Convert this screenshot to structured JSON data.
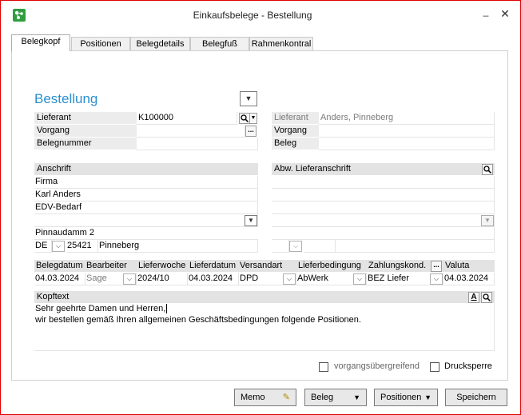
{
  "window": {
    "title": "Einkaufsbelege - Bestellung",
    "minimize": "_",
    "close": "✕"
  },
  "tabs": [
    {
      "label": "Belegkopf"
    },
    {
      "label": "Positionen"
    },
    {
      "label": "Belegdetails"
    },
    {
      "label": "Belegfuß"
    },
    {
      "label": "Rahmenkontral"
    }
  ],
  "heading": "Bestellung",
  "supplier_left": {
    "lieferant_label": "Lieferant",
    "lieferant_value": "K100000",
    "vorgang_label": "Vorgang",
    "vorgang_value": "",
    "belegnummer_label": "Belegnummer",
    "belegnummer_value": "",
    "ellipsis": "..."
  },
  "supplier_right": {
    "lieferant_label": "Lieferant",
    "lieferant_value": "Anders, Pinneberg",
    "vorgang_label": "Vorgang",
    "beleg_label": "Beleg"
  },
  "address": {
    "header": "Anschrift",
    "lines": [
      "Firma",
      "Karl Anders",
      "EDV-Bedarf"
    ],
    "street": "Pinnaudamm 2",
    "country": "DE",
    "zip": "25421",
    "city": "Pinneberg"
  },
  "alt_address": {
    "header": "Abw. Lieferanschrift"
  },
  "order_row": {
    "headers": {
      "belegdatum": "Belegdatum",
      "bearbeiter": "Bearbeiter",
      "lieferwoche": "Lieferwoche",
      "lieferdatum": "Lieferdatum",
      "versandart": "Versandart",
      "lieferbedingung": "Lieferbedingung",
      "zahlungskond": "Zahlungskond.",
      "ellipsis": "...",
      "valuta": "Valuta"
    },
    "values": {
      "belegdatum": "04.03.2024",
      "bearbeiter": "Sage",
      "lieferwoche": "2024/10",
      "lieferdatum": "04.03.2024",
      "versandart": "DPD",
      "lieferbedingung": "AbWerk",
      "zahlungskond": "BEZ Liefer",
      "valuta": "04.03.2024"
    }
  },
  "kopftext": {
    "header": "Kopftext",
    "line1": "Sehr geehrte Damen und Herren,",
    "line2": "wir bestellen gemäß Ihren allgemeinen Geschäftsbedingungen folgende Positionen.",
    "font_button": "A"
  },
  "checkboxes": {
    "vorgangsuebergreifend": "vorgangsübergreifend",
    "drucksperre": "Drucksperre"
  },
  "buttons": {
    "memo": "Memo",
    "beleg": "Beleg",
    "positionen": "Positionen",
    "speichern": "Speichern"
  },
  "colors": {
    "heading": "#2b8fcf",
    "window_border": "#e00000",
    "app_icon": "#2e9e3f"
  }
}
